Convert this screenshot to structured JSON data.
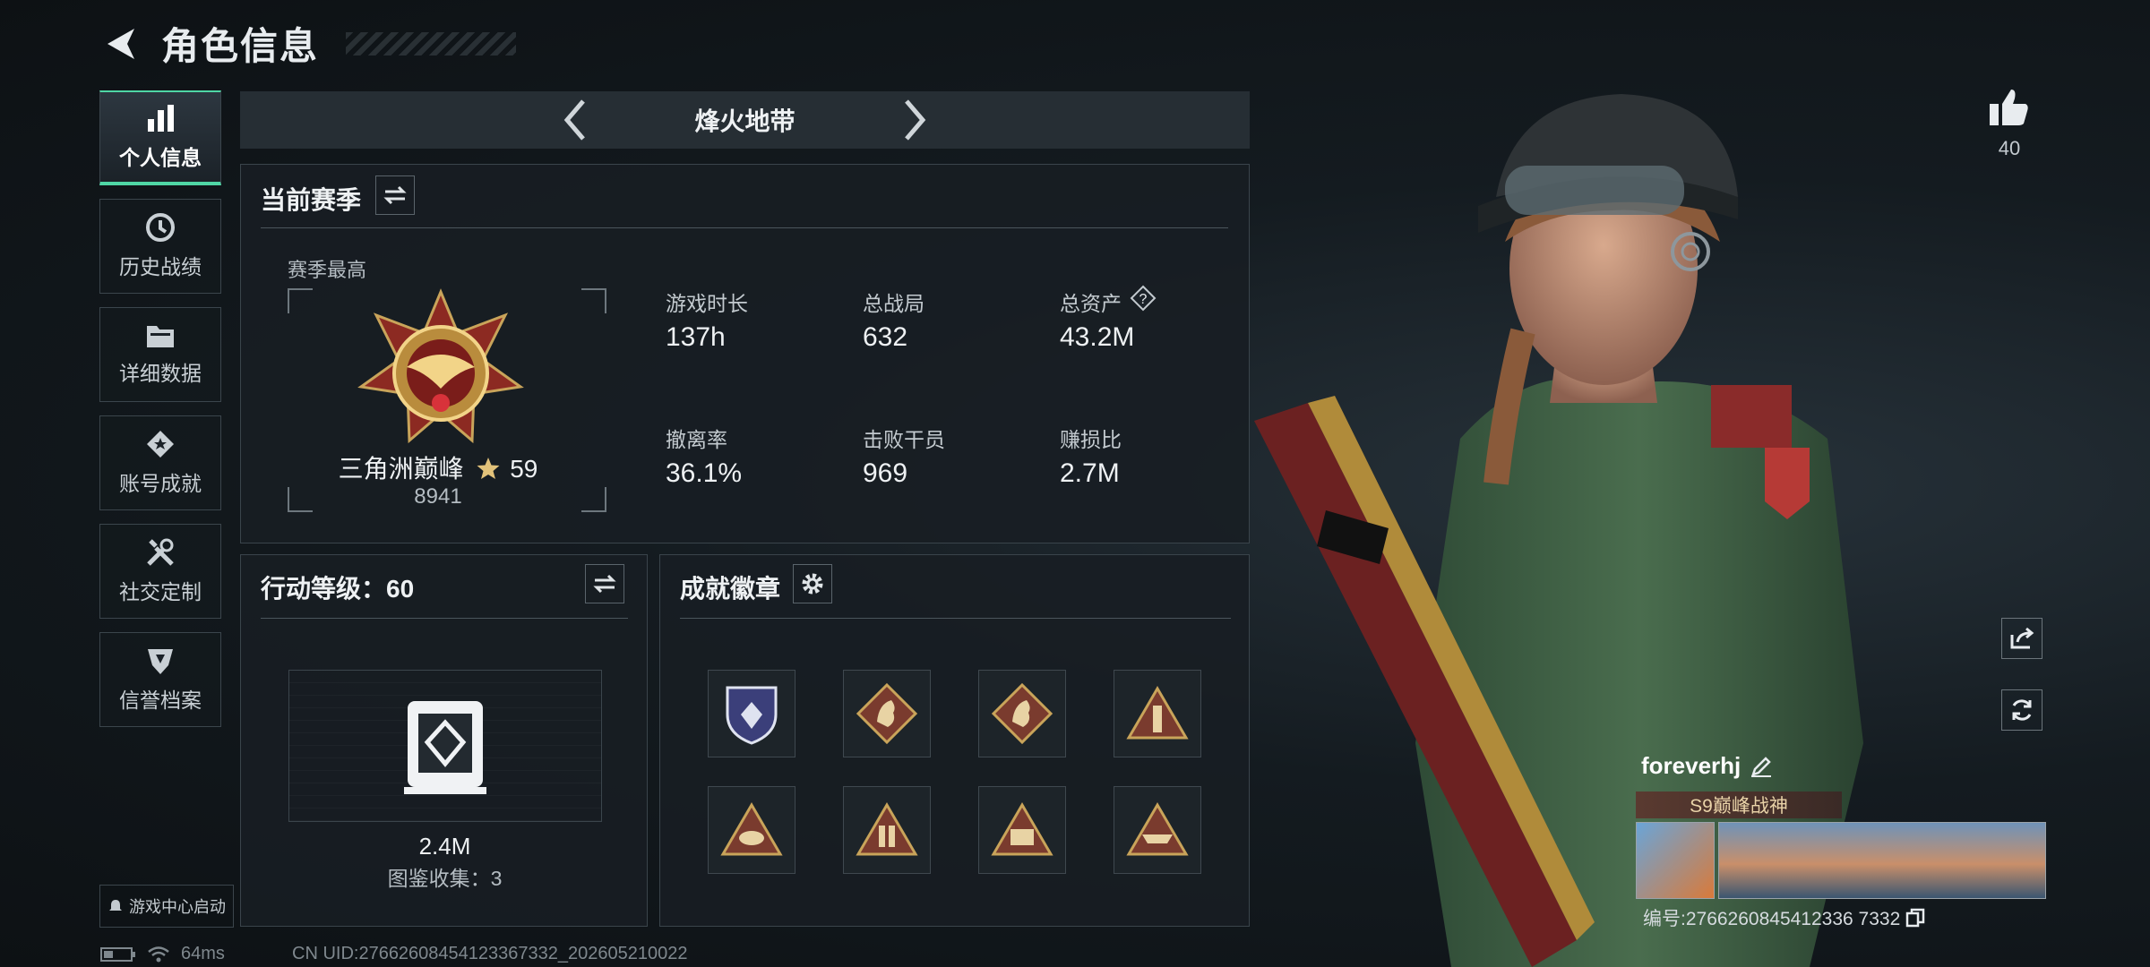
{
  "header": {
    "title": "角色信息"
  },
  "sidebar": {
    "items": [
      {
        "label": "个人信息",
        "active": true,
        "icon": "bar-chart-icon"
      },
      {
        "label": "历史战绩",
        "icon": "clock-icon"
      },
      {
        "label": "详细数据",
        "icon": "folder-icon"
      },
      {
        "label": "账号成就",
        "icon": "medal-icon"
      },
      {
        "label": "社交定制",
        "icon": "tools-icon"
      },
      {
        "label": "信誉档案",
        "icon": "shield-icon"
      }
    ]
  },
  "game_center": {
    "label": "游戏中心启动"
  },
  "mode": {
    "name": "烽火地带"
  },
  "season": {
    "title": "当前赛季",
    "best_label": "赛季最高",
    "rank_name": "三角洲巅峰",
    "rank_stars": "59",
    "rank_score": "8941",
    "stats": [
      {
        "label": "游戏时长",
        "value": "137h"
      },
      {
        "label": "总战局",
        "value": "632"
      },
      {
        "label": "总资产",
        "value": "43.2M"
      },
      {
        "label": "撤离率",
        "value": "36.1%"
      },
      {
        "label": "击败干员",
        "value": "969"
      },
      {
        "label": "赚损比",
        "value": "2.7M"
      }
    ]
  },
  "action_level": {
    "title": "行动等级：60",
    "value": "2.4M",
    "collection": "图鉴收集：3"
  },
  "achievements": {
    "title": "成就徽章"
  },
  "player": {
    "likes": "40",
    "name": "foreverhj",
    "title_badge": "S9巅峰战神",
    "id_line": "编号:2766260845412336 7332"
  },
  "footer": {
    "ping": "64ms",
    "uid": "CN UID:27662608454123367332_202605210022"
  },
  "colors": {
    "accent": "#4fd6a5",
    "gold": "#c9a45a",
    "badge_red": "#7a3b2e"
  }
}
